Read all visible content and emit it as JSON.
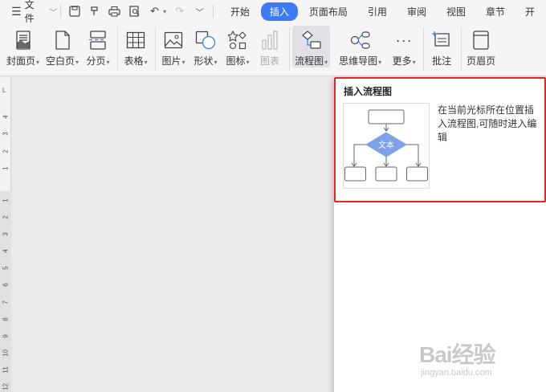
{
  "menu": {
    "file_label": "文件",
    "tabs": [
      {
        "label": "开始",
        "active": false
      },
      {
        "label": "插入",
        "active": true
      },
      {
        "label": "页面布局",
        "active": false
      },
      {
        "label": "引用",
        "active": false
      },
      {
        "label": "审阅",
        "active": false
      },
      {
        "label": "视图",
        "active": false
      },
      {
        "label": "章节",
        "active": false
      },
      {
        "label": "开",
        "active": false
      }
    ]
  },
  "ribbon": {
    "cover": "封面页",
    "blank": "空白页",
    "pagebreak": "分页",
    "table": "表格",
    "picture": "图片",
    "shape": "形状",
    "icon": "图标",
    "chart": "图表",
    "flowchart": "流程图",
    "mindmap": "思维导图",
    "more": "更多",
    "comment": "批注",
    "header": "页眉页"
  },
  "ruler": {
    "corner": "L",
    "numbers": [
      "4",
      "3",
      "2",
      "1",
      "1",
      "2",
      "3",
      "4",
      "5",
      "6",
      "7",
      "8",
      "9",
      "10",
      "11",
      "12"
    ]
  },
  "panel": {
    "title": "插入流程图",
    "description": "在当前光标所在位置插入流程图,可随时进入编辑",
    "thumb_text": "文本"
  },
  "watermark": {
    "big": "Bai经验",
    "small": "jingyan.baidu.com"
  },
  "colors": {
    "accent": "#3d7af5",
    "highlight": "#e62525",
    "diamond": "#7da2e8"
  }
}
